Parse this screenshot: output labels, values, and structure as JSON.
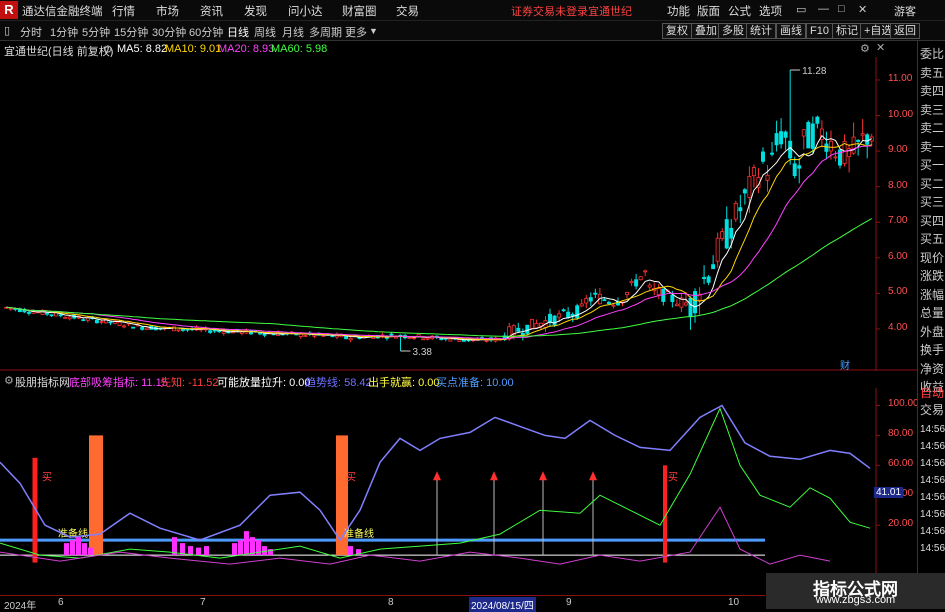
{
  "app": {
    "logo": "R",
    "title": "通达信金融终端",
    "menu": [
      "行情",
      "市场",
      "资讯",
      "发现",
      "问小达",
      "财富圈",
      "交易"
    ],
    "login_status": "证券交易未登录",
    "stock_name": "宜通世纪",
    "right_menu": [
      "功能",
      "版面",
      "公式",
      "选项"
    ],
    "guest": "游客",
    "window_controls": [
      "▭",
      "—",
      "□",
      "✕"
    ]
  },
  "toolbar": {
    "periods": [
      "分时",
      "1分钟",
      "5分钟",
      "15分钟",
      "30分钟",
      "60分钟",
      "日线",
      "周线",
      "月线",
      "多周期",
      "更多"
    ],
    "selected_period": "日线",
    "right_buttons": [
      "复权",
      "叠加",
      "多股",
      "统计",
      "画线",
      "F10",
      "标记",
      "+自选",
      "返回"
    ]
  },
  "main_chart": {
    "stock_label": "宜通世纪(日线 前复权)",
    "ma": [
      {
        "label": "MA5: 8.82",
        "color": "#ffffff"
      },
      {
        "label": "MA10: 9.01",
        "color": "#ffd700"
      },
      {
        "label": "MA20: 8.93",
        "color": "#ff40ff"
      },
      {
        "label": "MA60: 5.98",
        "color": "#40ff40"
      }
    ],
    "price_axis": [
      "11.00",
      "10.00",
      "9.00",
      "8.00",
      "7.00",
      "6.00",
      "5.00",
      "4.00"
    ],
    "high_label": "11.28",
    "low_label": "3.38",
    "cai_label": "财"
  },
  "indicator": {
    "name": "股朋指标网",
    "fields": [
      {
        "label": "底部吸筹指标: 11.15",
        "color": "#ff40ff"
      },
      {
        "label": "先知: -11.52",
        "color": "#ff4040"
      },
      {
        "label": "可能放量拉升: 0.00",
        "color": "#ffffff"
      },
      {
        "label": "趋势线: 58.42",
        "color": "#7070ff"
      },
      {
        "label": "出手就赢: 0.00",
        "color": "#ffff40"
      },
      {
        "label": "买点准备: 10.00",
        "color": "#4d9bff"
      }
    ],
    "axis": [
      "100.00",
      "80.00",
      "60.00",
      "40.00",
      "20.00"
    ],
    "current_value": "41.01",
    "buy_labels": [
      "买",
      "买",
      "买"
    ],
    "prep_labels": [
      "准备线",
      "准备线"
    ]
  },
  "right_panel": {
    "quote_tabs": [
      "委比",
      "卖五",
      "卖四",
      "卖三",
      "卖二",
      "卖一",
      "买一",
      "买二",
      "买三",
      "买四",
      "买五",
      "现价",
      "涨跌",
      "涨幅",
      "总量",
      "外盘",
      "换手",
      "净资",
      "收益"
    ],
    "lower_tabs": [
      "自动",
      "交易"
    ],
    "row_times": [
      "14:56",
      "14:56",
      "14:56",
      "14:56",
      "14:56",
      "14:56",
      "14:56",
      "14:56"
    ]
  },
  "date_axis": {
    "labels": [
      "2024年",
      "6",
      "7",
      "8",
      "2024/08/15/四",
      "9",
      "10"
    ]
  },
  "watermark": {
    "title": "指标公式网",
    "url": "www.zbgs3.com"
  }
}
